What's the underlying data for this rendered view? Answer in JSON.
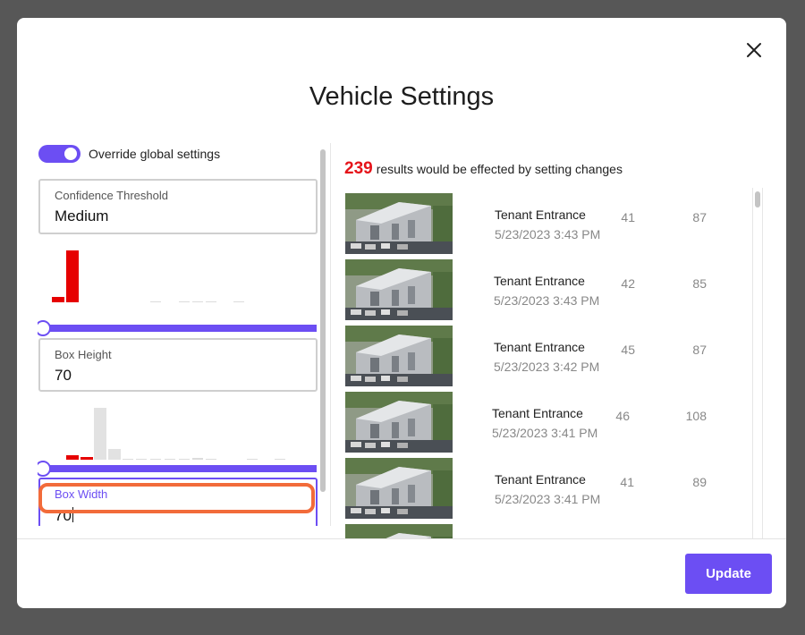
{
  "dialog": {
    "title": "Vehicle Settings",
    "close_icon": "close-icon",
    "update_label": "Update"
  },
  "settings": {
    "override_label": "Override global settings",
    "override_enabled": true,
    "confidence": {
      "label": "Confidence Threshold",
      "value": "Medium"
    },
    "box_height": {
      "label": "Box Height",
      "value": "70"
    },
    "box_width": {
      "label": "Box Width",
      "value": "70"
    }
  },
  "summary": {
    "count": "239",
    "text": "results would be effected by setting changes"
  },
  "results": [
    {
      "title": "Tenant Entrance",
      "date": "5/23/2023 3:43 PM",
      "n1": "41",
      "n2": "87"
    },
    {
      "title": "Tenant Entrance",
      "date": "5/23/2023 3:43 PM",
      "n1": "42",
      "n2": "85"
    },
    {
      "title": "Tenant Entrance",
      "date": "5/23/2023 3:42 PM",
      "n1": "45",
      "n2": "87"
    },
    {
      "title": "Tenant Entrance",
      "date": "5/23/2023 3:41 PM",
      "n1": "46",
      "n2": "108"
    },
    {
      "title": "Tenant Entrance",
      "date": "5/23/2023 3:41 PM",
      "n1": "41",
      "n2": "89"
    }
  ],
  "colors": {
    "accent": "#6c4ef3",
    "count": "#e5141a",
    "highlight": "#f26b3a"
  }
}
